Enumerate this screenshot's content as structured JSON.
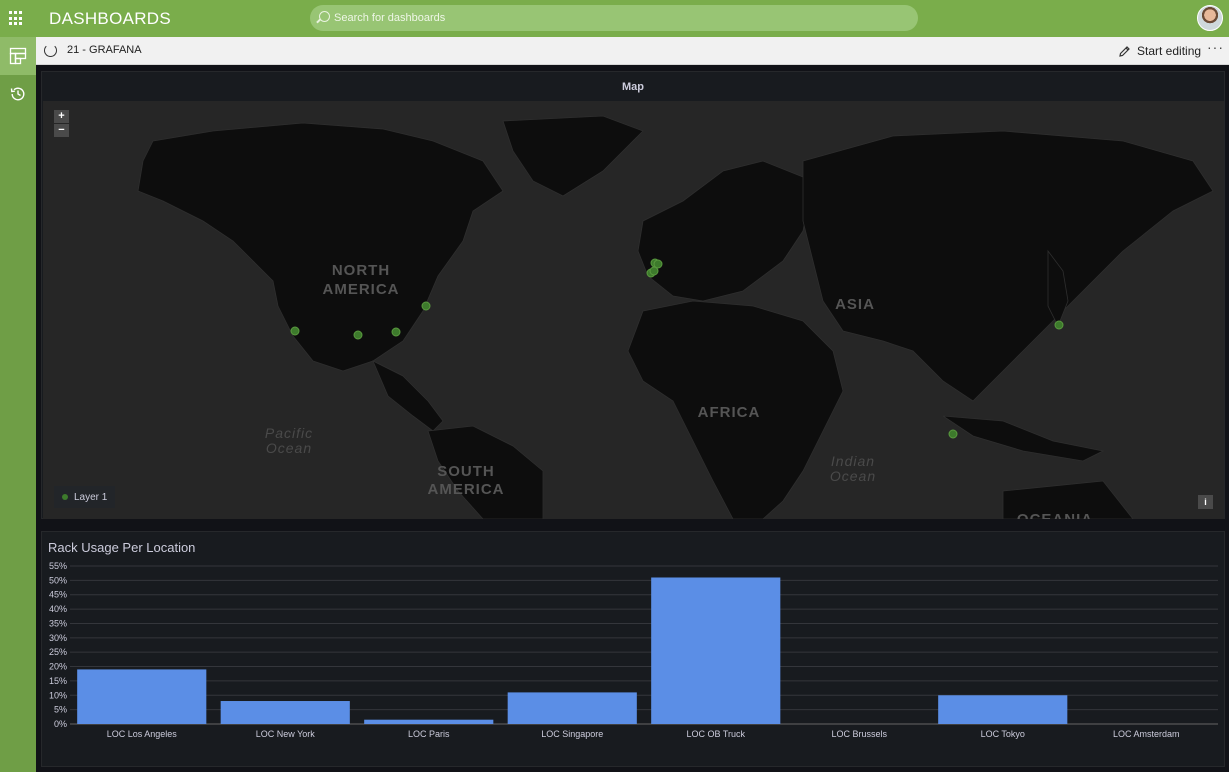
{
  "header": {
    "title": "DASHBOARDS",
    "search_placeholder": "Search for dashboards"
  },
  "subbar": {
    "breadcrumb": "21 - GRAFANA",
    "edit_label": "Start editing",
    "more_label": "···"
  },
  "map_panel": {
    "title": "Map",
    "zoom_in": "+",
    "zoom_out": "−",
    "legend_label": "Layer 1",
    "info_label": "i",
    "continent_labels": [
      "NORTH",
      "AMERICA",
      "SOUTH",
      "AMERICA",
      "AFRICA",
      "ASIA",
      "OCEANIA"
    ],
    "ocean_labels": [
      "Pacific",
      "Ocean",
      "Indian",
      "Ocean"
    ],
    "marker_color": "#3d7a2c"
  },
  "chart_data": {
    "type": "bar",
    "title": "Rack Usage Per Location",
    "categories": [
      "LOC Los Angeles",
      "LOC New York",
      "LOC Paris",
      "LOC Singapore",
      "LOC OB Truck",
      "LOC Brussels",
      "LOC Tokyo",
      "LOC Amsterdam"
    ],
    "values": [
      19,
      8,
      1.5,
      11,
      51,
      0,
      10,
      0
    ],
    "y_ticks": [
      "0%",
      "5%",
      "10%",
      "15%",
      "20%",
      "25%",
      "30%",
      "35%",
      "40%",
      "45%",
      "50%",
      "55%"
    ],
    "ylim": [
      0,
      55
    ],
    "grid": true,
    "bar_color": "#5b8ee6"
  }
}
